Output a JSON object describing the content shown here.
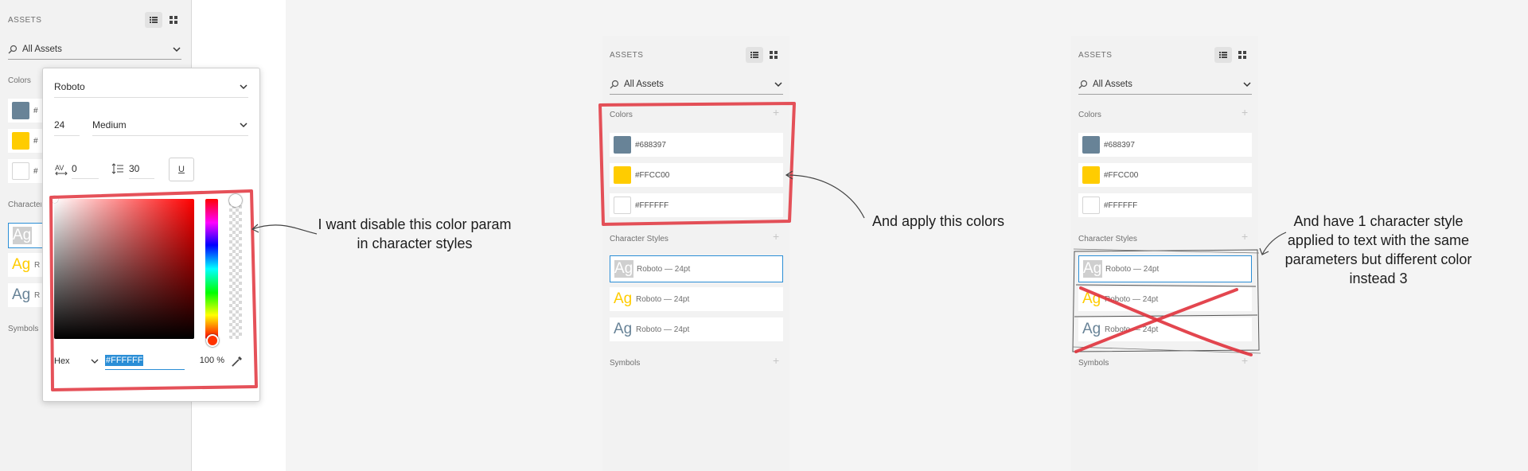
{
  "panel": {
    "assets_label": "ASSETS",
    "search_text": "All Assets",
    "colors_label": "Colors",
    "character_styles_label": "Character Styles",
    "symbols_label": "Symbols",
    "colors": [
      {
        "hex": "#688397",
        "swatch": "#688397"
      },
      {
        "hex": "#FFCC00",
        "swatch": "#FFCC00"
      },
      {
        "hex": "#FFFFFF",
        "swatch": "#FFFFFF"
      }
    ],
    "styles": [
      {
        "glyph": "Ag",
        "text": "Roboto — 24pt",
        "color": "#ffffff"
      },
      {
        "glyph": "Ag",
        "text": "Roboto — 24pt",
        "color": "#FFCC00"
      },
      {
        "glyph": "Ag",
        "text": "Roboto — 24pt",
        "color": "#688397"
      }
    ],
    "left_partial_hex_prefix": "#"
  },
  "popover": {
    "font_family": "Roboto",
    "font_size": "24",
    "font_weight": "Medium",
    "letter_spacing": "0",
    "line_height": "30",
    "underline_glyph": "U",
    "color_mode": "Hex",
    "hex_value": "#FFFFFF",
    "opacity": "100 %"
  },
  "annotations": {
    "disable_color": "I want disable this color param in character styles",
    "apply_colors": "And apply this colors",
    "one_style": "And have 1 character style applied to text with the same parameters but different color instead 3"
  },
  "colors": {
    "accent_blue": "#2b8ed6",
    "red_marker": "#e0323c",
    "hue_top": "#ff0000"
  }
}
